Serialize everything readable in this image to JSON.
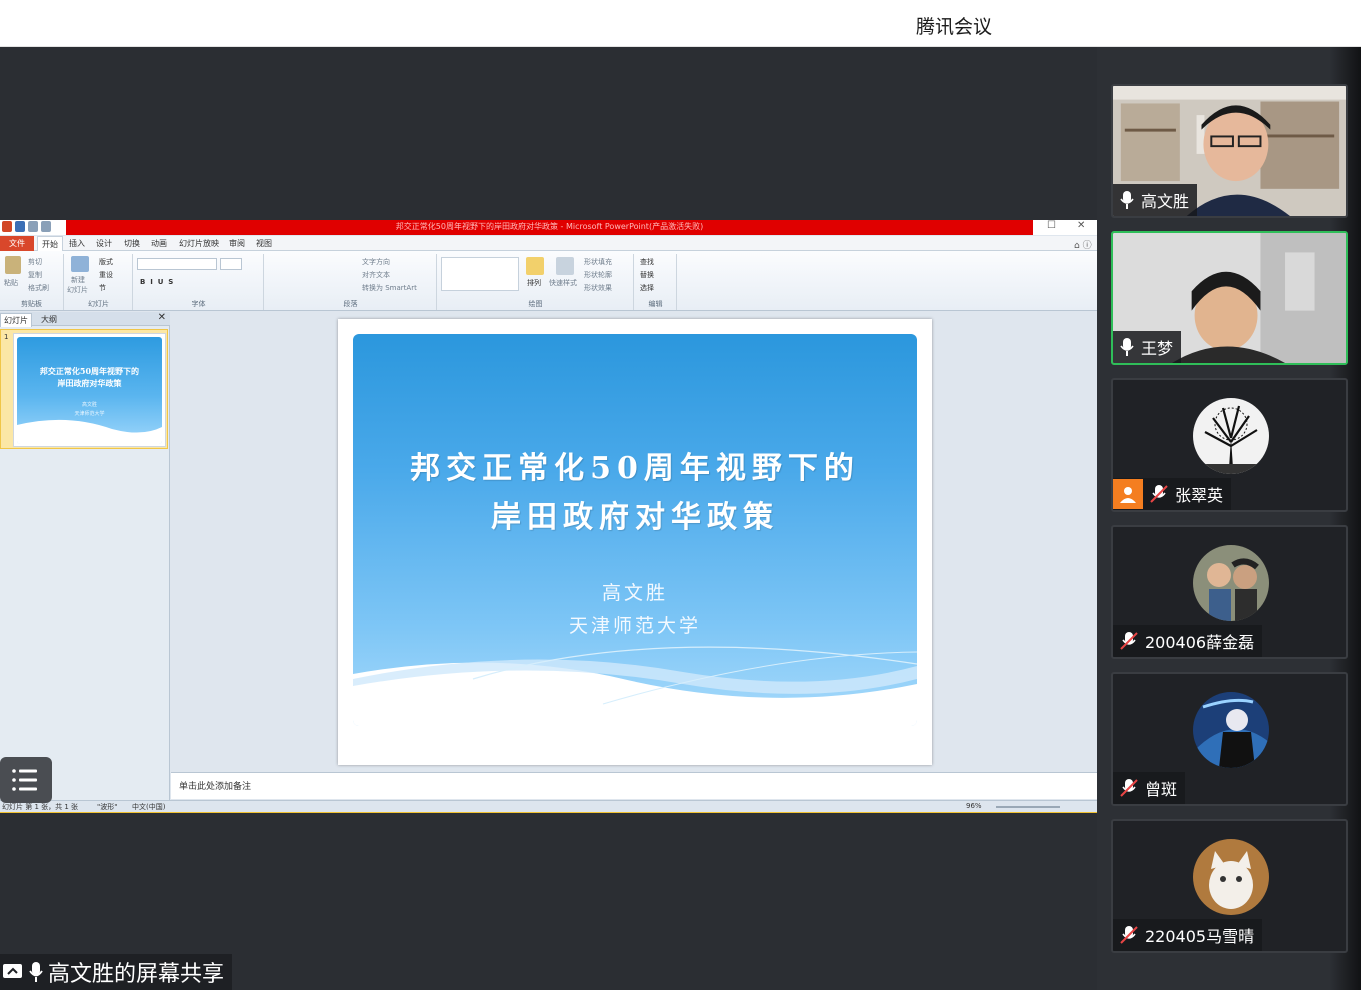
{
  "app": {
    "title": "腾讯会议"
  },
  "ppt": {
    "window_title": "邦交正常化50周年视野下的岸田政府对华政策 - Microsoft PowerPoint(产品激活失败)",
    "tabs": [
      "文件",
      "开始",
      "插入",
      "设计",
      "切换",
      "动画",
      "幻灯片放映",
      "审阅",
      "视图"
    ],
    "ribbon": {
      "clipboard": {
        "label": "剪贴板",
        "paste": "粘贴",
        "cut": "剪切",
        "copy": "复制",
        "format_painter": "格式刷"
      },
      "slides": {
        "label": "幻灯片",
        "new_slide": "新建",
        "new_slide2": "幻灯片",
        "layout": "版式",
        "reset": "重设",
        "section": "节"
      },
      "font": {
        "label": "字体"
      },
      "paragraph": {
        "label": "段落",
        "text_direction": "文字方向",
        "align_text": "对齐文本",
        "smartart": "转换为 SmartArt"
      },
      "drawing": {
        "label": "绘图",
        "arrange": "排列",
        "quick_styles": "快速样式",
        "shape_fill": "形状填充",
        "shape_outline": "形状轮廓",
        "shape_effects": "形状效果"
      },
      "editing": {
        "label": "编辑",
        "find": "查找",
        "replace": "替换",
        "select": "选择"
      }
    },
    "pane_tabs": [
      "幻灯片",
      "大纲"
    ],
    "thumb_number": "1",
    "slide": {
      "title_line1": "邦交正常化50周年视野下的",
      "title_line2": "岸田政府对华政策",
      "author": "高文胜",
      "university": "天津师范大学"
    },
    "notes_placeholder": "单击此处添加备注",
    "status": {
      "slide_count": "幻灯片 第 1 张，共 1 张",
      "theme": "\"波形\"",
      "language": "中文(中国)",
      "zoom": "96%"
    }
  },
  "share_label": "高文胜的屏幕共享",
  "participants": [
    {
      "name": "高文胜",
      "mic": "on",
      "speaking": false,
      "video": true
    },
    {
      "name": "王梦",
      "mic": "on",
      "speaking": true,
      "video": true
    },
    {
      "name": "张翠英",
      "mic": "muted",
      "speaking": false,
      "video": false
    },
    {
      "name": "200406薛金磊",
      "mic": "muted",
      "speaking": false,
      "video": false
    },
    {
      "name": "曾斑",
      "mic": "muted",
      "speaking": false,
      "video": false
    },
    {
      "name": "220405马雪晴",
      "mic": "muted",
      "speaking": false,
      "video": false
    }
  ],
  "colors": {
    "speaking_border": "#2fbe59",
    "ppt_title_bar": "#e00000",
    "file_tab": "#d9472b"
  }
}
